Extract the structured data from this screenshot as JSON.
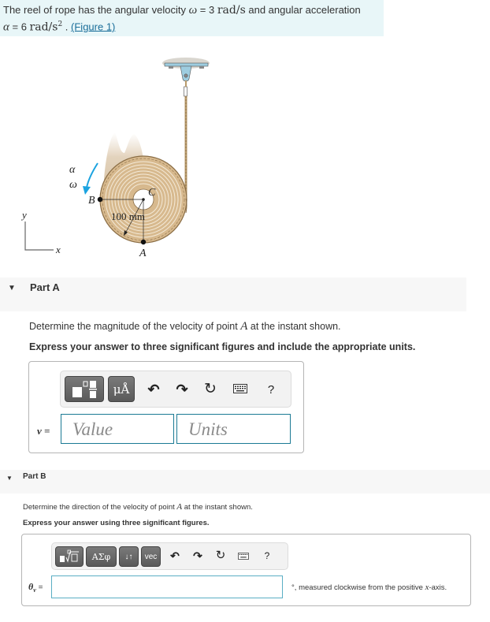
{
  "intro": {
    "text_1": "The reel of rope has the angular velocity",
    "omega_symbol": "ω",
    "omega_eq": " = 3 ",
    "omega_unit": "rad/s",
    "text_2": " and angular acceleration",
    "alpha_symbol": "α",
    "alpha_eq": " = 6 ",
    "alpha_unit": "rad/s",
    "alpha_unit_exp": "2",
    "sep": " . ",
    "figure_link": "(Figure 1)"
  },
  "figure": {
    "label_alpha": "α",
    "label_omega": "ω",
    "label_B": "B",
    "label_C": "C",
    "label_A": "A",
    "label_radius": "100 mm",
    "axis_y": "y",
    "axis_x": "x",
    "colors": {
      "reel": "#d7b98e",
      "arrow": "#1ba3e0",
      "bracket": "#a9d3e6"
    }
  },
  "part_a": {
    "title": "Part A",
    "question_pre": "Determine the magnitude of the velocity of point ",
    "question_var": "A",
    "question_post": " at the instant shown.",
    "instruction": "Express your answer to three significant figures and include the appropriate units.",
    "toolbar": {
      "templates_icon": "fraction-template-icon",
      "units_label": "μÅ",
      "undo": "↶",
      "redo": "↷",
      "reset": "↻",
      "keyboard": "keyboard-icon",
      "help": "?"
    },
    "var_label": "v =",
    "value_placeholder": "Value",
    "units_placeholder": "Units"
  },
  "part_b": {
    "title": "Part B",
    "question_pre": "Determine the direction of the velocity of point ",
    "question_var": "A",
    "question_post": " at the instant shown.",
    "instruction": "Express your answer using three significant figures.",
    "toolbar": {
      "templates_icon": "root-template-icon",
      "greek_label": "ΑΣφ",
      "sort_label": "↓↑",
      "vec_label": "vec",
      "undo": "↶",
      "redo": "↷",
      "reset": "↻",
      "keyboard": "keyboard-icon",
      "help": "?"
    },
    "var_label": "θ",
    "var_sub": "v",
    "var_eq": " =",
    "suffix_pre": "°, measured clockwise from the positive ",
    "suffix_var": "x",
    "suffix_post": "-axis."
  }
}
